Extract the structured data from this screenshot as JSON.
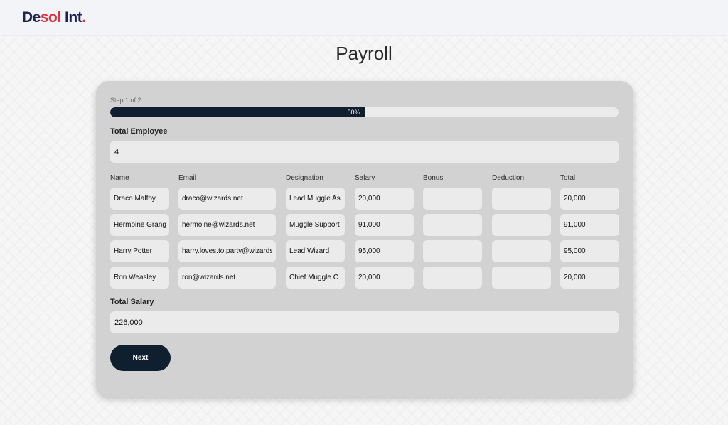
{
  "header": {
    "logo_part1": "De",
    "logo_part2": "sol",
    "logo_part3": " Int",
    "logo_dot": "."
  },
  "page": {
    "title": "Payroll"
  },
  "form": {
    "step_label": "Step 1 of 2",
    "progress_percent": 50,
    "progress_text": "50%",
    "total_employee_label": "Total Employee",
    "total_employee_value": "4",
    "columns": [
      "Name",
      "Email",
      "Designation",
      "Salary",
      "Bonus",
      "Deduction",
      "Total"
    ],
    "rows": [
      {
        "name": "Draco Malfoy",
        "email": "draco@wizards.net",
        "designation": "Lead Muggle Assistant",
        "salary": "20,000",
        "bonus": "",
        "deduction": "",
        "total": "20,000"
      },
      {
        "name": "Hermoine Granger",
        "email": "hermoine@wizards.net",
        "designation": "Muggle Support",
        "salary": "91,000",
        "bonus": "",
        "deduction": "",
        "total": "91,000"
      },
      {
        "name": "Harry Potter",
        "email": "harry.loves.to.party@wizards.net",
        "designation": "Lead Wizard",
        "salary": "95,000",
        "bonus": "",
        "deduction": "",
        "total": "95,000"
      },
      {
        "name": "Ron Weasley",
        "email": "ron@wizards.net",
        "designation": "Chief Muggle C",
        "salary": "20,000",
        "bonus": "",
        "deduction": "",
        "total": "20,000"
      }
    ],
    "total_salary_label": "Total Salary",
    "total_salary_value": "226,000",
    "next_label": "Next"
  },
  "colors": {
    "brand_navy": "#1c2350",
    "brand_red": "#e2313f",
    "primary_dark": "#0f1f2f",
    "card_bg": "#d2d2d2",
    "input_bg": "#ebebeb"
  }
}
